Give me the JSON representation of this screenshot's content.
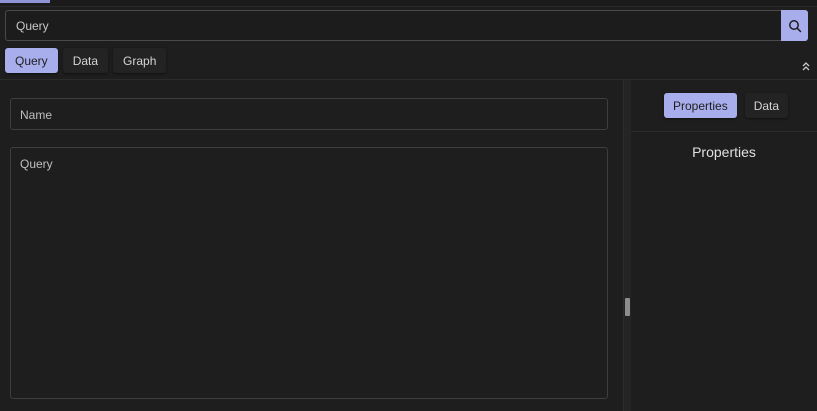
{
  "search": {
    "value": "Query"
  },
  "main_tabs": [
    {
      "label": "Query",
      "active": true
    },
    {
      "label": "Data",
      "active": false
    },
    {
      "label": "Graph",
      "active": false
    }
  ],
  "editor": {
    "name_placeholder": "Name",
    "query_placeholder": "Query"
  },
  "side_panel": {
    "tabs": [
      {
        "label": "Properties",
        "active": true
      },
      {
        "label": "Data",
        "active": false
      }
    ],
    "title": "Properties"
  },
  "icons": {
    "search": "search-icon",
    "collapse": "double-chevron-up-icon"
  },
  "colors": {
    "accent": "#a8aeec",
    "background": "#1e1e1e"
  }
}
